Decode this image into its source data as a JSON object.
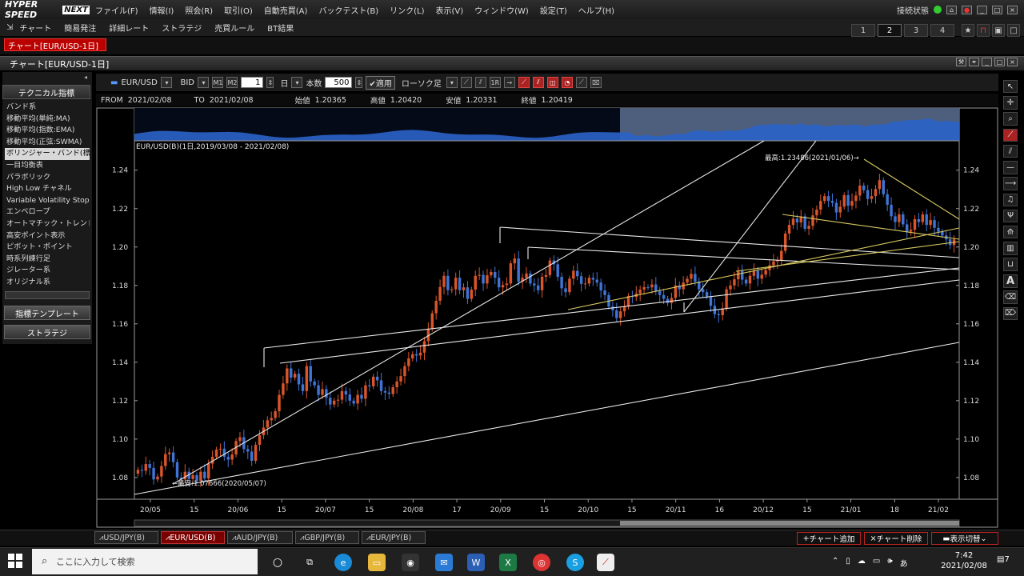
{
  "app": {
    "logo": "HYPER SPEED",
    "logo_badge": "NEXT",
    "menu": [
      "ファイル(F)",
      "情報(I)",
      "照会(R)",
      "取引(O)",
      "自動売買(A)",
      "バックテスト(B)",
      "リンク(L)",
      "表示(V)",
      "ウィンドウ(W)",
      "設定(T)",
      "ヘルプ(H)"
    ],
    "status_label": "接続状態",
    "toolbar": [
      "チャート",
      "簡易発注",
      "詳細レート",
      "ストラテジ",
      "売買ルール",
      "BT結果"
    ],
    "num_tabs": [
      "1",
      "2",
      "3",
      "4"
    ],
    "active_num_tab": "2",
    "red_tab": "チャート[EUR/USD-1日]",
    "window_title": "チャート[EUR/USD-1日]"
  },
  "left_panel": {
    "header": "テクニカル指標",
    "indicators": [
      "バンド系",
      "移動平均(単純:MA)",
      "移動平均(指数:EMA)",
      "移動平均(正弦:SWMA)",
      "ボリンジャー・バンド(標準)",
      "一目均衡表",
      "パラボリック",
      "High Low チャネル",
      "Variable Volatility Stops",
      "エンベロープ",
      "オートマチック・トレンドライン",
      "高安ポイント表示",
      "ピボット・ポイント",
      "時系列練行足",
      "ジレーター系",
      "オリジナル系"
    ],
    "selected_index": 4,
    "template_button": "指標テンプレート",
    "strategy_button": "ストラテジ"
  },
  "chart_toolbar": {
    "symbol": "EUR/USD",
    "price_type": "BID",
    "period_value": "1",
    "period_unit": "日",
    "count_label": "本数",
    "count_value": "500",
    "apply_label": "適用",
    "candle_label": "ローソク足"
  },
  "info": {
    "from_label": "FROM",
    "from": "2021/02/08",
    "to_label": "TO",
    "to": "2021/02/08",
    "open_label": "始値",
    "open": "1.20365",
    "high_label": "高値",
    "high": "1.20420",
    "low_label": "安値",
    "low": "1.20331",
    "close_label": "終値",
    "close": "1.20419"
  },
  "chart_data": {
    "type": "candlestick",
    "title": "EUR/USD(B)(1日,2019/03/08 - 2021/02/08)",
    "y_ticks": [
      "1.24",
      "1.22",
      "1.20",
      "1.18",
      "1.16",
      "1.14",
      "1.12",
      "1.10",
      "1.08"
    ],
    "ylim": [
      1.0687,
      1.2553
    ],
    "x_ticks": [
      "20/05",
      "15",
      "20/06",
      "15",
      "20/07",
      "15",
      "20/08",
      "17",
      "20/09",
      "15",
      "20/10",
      "15",
      "20/11",
      "16",
      "20/12",
      "15",
      "21/01",
      "18",
      "21/02"
    ],
    "high_annotation": "最高:1.23486(2021/01/06)→",
    "low_annotation": "←最安:1.07666(2020/05/07)",
    "colors": {
      "up": "#d9552a",
      "down": "#3f74d4",
      "line": "#e8e8e8",
      "trend": "#d7c860",
      "grid": "#8a8a8a"
    },
    "closes": [
      1.084,
      1.0835,
      1.087,
      1.085,
      1.079,
      1.0805,
      1.086,
      1.0922,
      1.093,
      1.088,
      1.08,
      1.079,
      1.083,
      1.0792,
      1.0812,
      1.0783,
      1.083,
      1.0795,
      1.0872,
      1.0908,
      1.0945,
      1.095,
      1.0908,
      1.0893,
      1.092,
      1.099,
      1.101,
      1.0948,
      1.0935,
      1.0887,
      1.097,
      1.102,
      1.106,
      1.1098,
      1.111,
      1.1145,
      1.123,
      1.129,
      1.1368,
      1.132,
      1.134,
      1.1285,
      1.125,
      1.138,
      1.13,
      1.128,
      1.123,
      1.126,
      1.1215,
      1.118,
      1.12,
      1.1205,
      1.125,
      1.1232,
      1.12,
      1.1185,
      1.123,
      1.121,
      1.128,
      1.1275,
      1.1325,
      1.1306,
      1.125,
      1.1242,
      1.1235,
      1.127,
      1.13,
      1.1328,
      1.138,
      1.142,
      1.1442,
      1.1435,
      1.145,
      1.151,
      1.1575,
      1.1655,
      1.172,
      1.1792,
      1.185,
      1.1775,
      1.178,
      1.184,
      1.1775,
      1.179,
      1.173,
      1.1778,
      1.185,
      1.1855,
      1.181,
      1.1853,
      1.187,
      1.184,
      1.179,
      1.1802,
      1.181,
      1.1915,
      1.194,
      1.182,
      1.184,
      1.1862,
      1.181,
      1.18,
      1.1775,
      1.1845,
      1.1854,
      1.193,
      1.191,
      1.1845,
      1.1785,
      1.1765,
      1.1835,
      1.1876,
      1.1848,
      1.1808,
      1.181,
      1.184,
      1.183,
      1.1815,
      1.1774,
      1.175,
      1.169,
      1.167,
      1.163,
      1.1665,
      1.169,
      1.1745,
      1.174,
      1.1758,
      1.1778,
      1.1791,
      1.179,
      1.1805,
      1.177,
      1.175,
      1.173,
      1.1708,
      1.1735,
      1.18,
      1.178,
      1.1815,
      1.1835,
      1.186,
      1.182,
      1.178,
      1.1765,
      1.1742,
      1.1694,
      1.165,
      1.1645,
      1.168,
      1.178,
      1.18,
      1.1832,
      1.1876,
      1.183,
      1.181,
      1.185,
      1.1876,
      1.1835,
      1.1856,
      1.188,
      1.1905,
      1.1925,
      1.193,
      1.198,
      1.207,
      1.2115,
      1.2148,
      1.2128,
      1.216,
      1.2095,
      1.211,
      1.2165,
      1.2195,
      1.224,
      1.2265,
      1.224,
      1.223,
      1.218,
      1.221,
      1.227,
      1.2215,
      1.224,
      1.2268,
      1.232,
      1.2296,
      1.225,
      1.2265,
      1.2302,
      1.2348,
      1.2275,
      1.222,
      1.216,
      1.213,
      1.217,
      1.2118,
      1.208,
      1.209,
      1.2145,
      1.213,
      1.217,
      1.2115,
      1.214,
      1.21,
      1.208,
      1.206,
      1.204,
      1.201,
      1.204
    ]
  },
  "bottom_tabs": [
    "USD/JPY(B)",
    "EUR/USD(B)",
    "AUD/JPY(B)",
    "GBP/JPY(B)",
    "EUR/JPY(B)"
  ],
  "active_bottom_tab": "EUR/USD(B)",
  "bottom_buttons": {
    "add": "チャート追加",
    "delete": "チャート削除",
    "toggle": "表示切替"
  },
  "taskbar": {
    "search_placeholder": "ここに入力して検索",
    "time": "7:42",
    "date": "2021/02/08",
    "notifications": "7"
  }
}
